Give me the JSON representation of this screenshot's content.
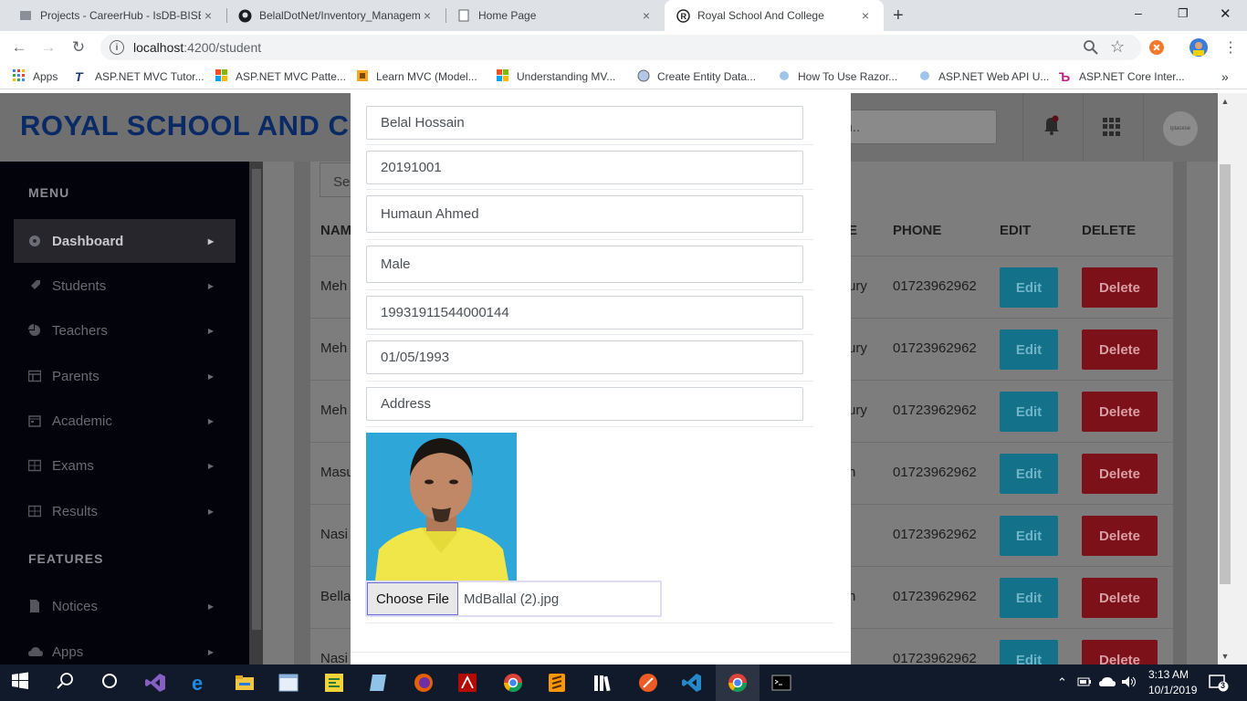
{
  "browser": {
    "tabs": [
      {
        "title": "Projects - CareerHub - IsDB-BISEW",
        "close": "×"
      },
      {
        "title": "BelalDotNet/Inventory_Management",
        "close": "×"
      },
      {
        "title": "Home Page",
        "close": "×"
      },
      {
        "title": "Royal School And College",
        "close": "×",
        "active": true
      }
    ],
    "new_tab": "+",
    "window_controls": {
      "minimize": "–",
      "maximize": "❐",
      "close": "✕"
    },
    "url_host": "localhost",
    "url_path": ":4200/student",
    "bookmarks": [
      {
        "label": "Apps",
        "icon": "apps-grid-icon"
      },
      {
        "label": "ASP.NET MVC Tutor...",
        "icon": "tutorialsteacher-icon"
      },
      {
        "label": "ASP.NET MVC Patte...",
        "icon": "microsoft-icon"
      },
      {
        "label": "Learn MVC (Model...",
        "icon": "codeproject-icon"
      },
      {
        "label": "Understanding MV...",
        "icon": "microsoft-icon"
      },
      {
        "label": "Create Entity Data...",
        "icon": "globe-icon"
      },
      {
        "label": "How To Use Razor...",
        "icon": "csharpcorner-icon"
      },
      {
        "label": "ASP.NET Web API U...",
        "icon": "csharpcorner-icon"
      },
      {
        "label": "ASP.NET Core Inter...",
        "icon": "dotnettricks-icon"
      }
    ],
    "bookmarks_overflow": "»"
  },
  "app": {
    "title": "ROYAL SCHOOL AND C",
    "search_placeholder": "rch..",
    "avatar_text": "iplacese"
  },
  "sidebar": {
    "heading_menu": "MENU",
    "heading_features": "FEATURES",
    "items": [
      {
        "label": "Dashboard",
        "icon": "dashboard-icon",
        "arrow": "▶"
      },
      {
        "label": "Students",
        "icon": "rocket-icon",
        "arrow": "▶"
      },
      {
        "label": "Teachers",
        "icon": "pie-chart-icon",
        "arrow": "▶"
      },
      {
        "label": "Parents",
        "icon": "table-icon",
        "arrow": "▶"
      },
      {
        "label": "Academic",
        "icon": "calendar-icon",
        "arrow": "▶"
      },
      {
        "label": "Exams",
        "icon": "grid-icon",
        "arrow": "▶"
      },
      {
        "label": "Results",
        "icon": "grid-icon",
        "arrow": "▶"
      },
      {
        "label": "Notices",
        "icon": "document-icon",
        "arrow": "▶"
      },
      {
        "label": "Apps",
        "icon": "cloud-icon",
        "arrow": "▶"
      }
    ]
  },
  "table": {
    "filter_text": "Se",
    "headers": {
      "name": "NAM",
      "address": "E",
      "phone": "PHONE",
      "edit": "EDIT",
      "delete": "DELETE"
    },
    "rows": [
      {
        "name": "Meh",
        "address": "ury",
        "phone": "01723962962",
        "edit": "Edit",
        "delete": "Delete"
      },
      {
        "name": "Meh",
        "address": "ury",
        "phone": "01723962962",
        "edit": "Edit",
        "delete": "Delete"
      },
      {
        "name": "Meh",
        "address": "ury",
        "phone": "01723962962",
        "edit": "Edit",
        "delete": "Delete"
      },
      {
        "name": "Masu",
        "address": "n",
        "phone": "01723962962",
        "edit": "Edit",
        "delete": "Delete"
      },
      {
        "name": "Nasi",
        "address": "",
        "phone": "01723962962",
        "edit": "Edit",
        "delete": "Delete"
      },
      {
        "name": "Bella",
        "address": "n",
        "phone": "01723962962",
        "edit": "Edit",
        "delete": "Delete"
      },
      {
        "name": "Nasi",
        "address": "",
        "phone": "01723962962",
        "edit": "Edit",
        "delete": "Delete"
      }
    ]
  },
  "modal": {
    "fields": {
      "name": "Belal Hossain",
      "student_id": "20191001",
      "father_name": "Humaun Ahmed",
      "gender": "Male",
      "nid": "19931911544000144",
      "dob": "01/05/1993",
      "address_placeholder": "Address"
    },
    "file_button": "Choose File",
    "file_name": "MdBallal (2).jpg"
  },
  "taskbar": {
    "time": "3:13 AM",
    "date": "10/1/2019",
    "notification_count": "3"
  }
}
